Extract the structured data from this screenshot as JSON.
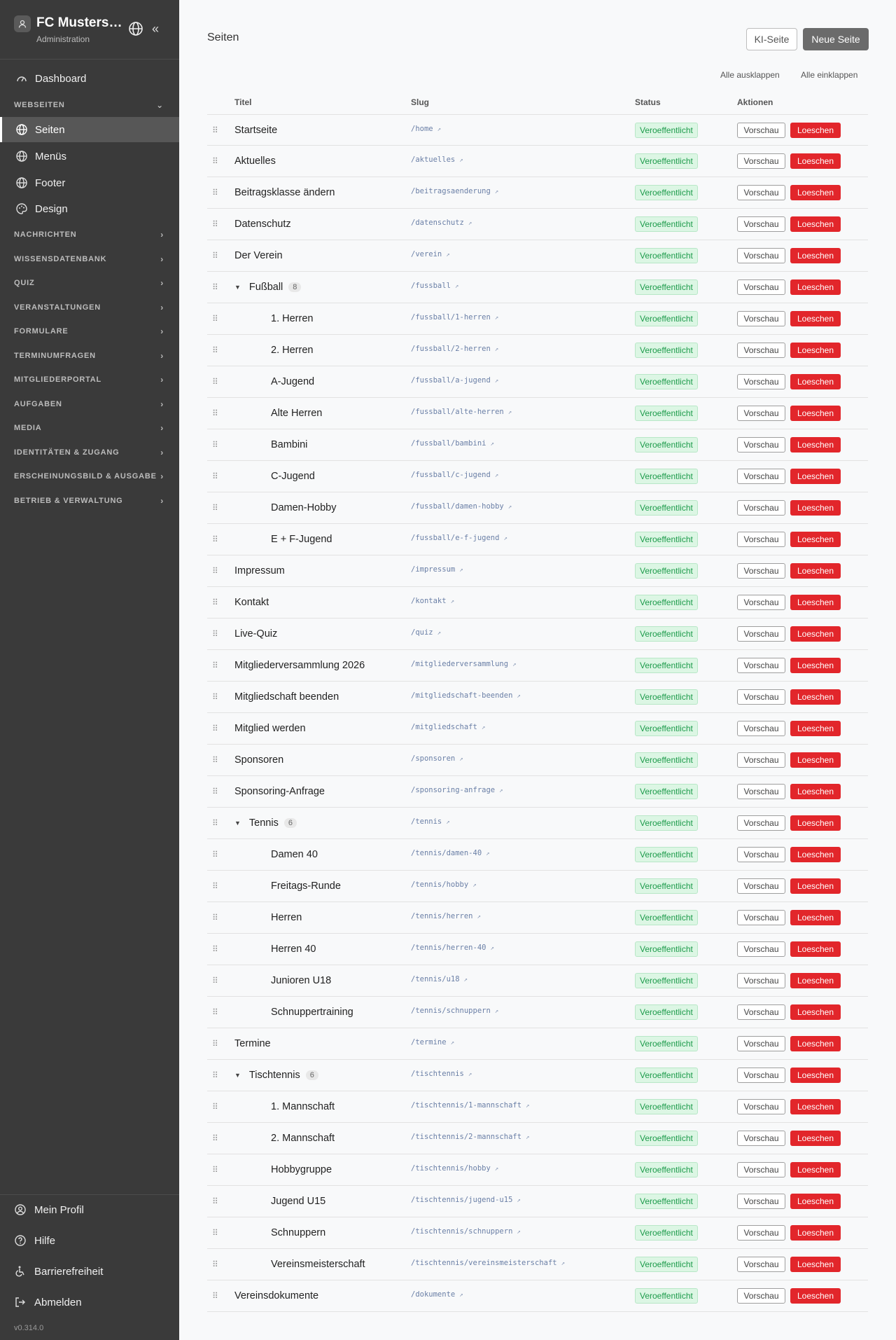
{
  "brand": {
    "name": "FC Musterst…",
    "subtitle": "Administration"
  },
  "nav": {
    "dashboard": "Dashboard",
    "webseiten_section": "WEBSEITEN",
    "webseiten_items": [
      "Seiten",
      "Menüs",
      "Footer",
      "Design"
    ],
    "sections": [
      "NACHRICHTEN",
      "WISSENSDATENBANK",
      "QUIZ",
      "VERANSTALTUNGEN",
      "FORMULARE",
      "TERMINUMFRAGEN",
      "MITGLIEDERPORTAL",
      "AUFGABEN",
      "MEDIA",
      "IDENTITÄTEN & ZUGANG",
      "ERSCHEINUNGSBILD & AUSGABE",
      "BETRIEB & VERWALTUNG"
    ]
  },
  "bottom": {
    "profile": "Mein Profil",
    "help": "Hilfe",
    "accessibility": "Barrierefreiheit",
    "logout": "Abmelden",
    "version": "v0.314.0"
  },
  "header": {
    "title": "Seiten",
    "ki_button": "KI-Seite",
    "new_button": "Neue Seite",
    "expand_all": "Alle ausklappen",
    "collapse_all": "Alle einklappen"
  },
  "table": {
    "columns": {
      "title": "Titel",
      "slug": "Slug",
      "status": "Status",
      "actions": "Aktionen"
    },
    "status_label": "Veroeffentlicht",
    "preview_label": "Vorschau",
    "delete_label": "Loeschen",
    "rows": [
      {
        "title": "Startseite",
        "slug": "/home",
        "level": 0
      },
      {
        "title": "Aktuelles",
        "slug": "/aktuelles",
        "level": 0
      },
      {
        "title": "Beitragsklasse ändern",
        "slug": "/beitragsaenderung",
        "level": 0
      },
      {
        "title": "Datenschutz",
        "slug": "/datenschutz",
        "level": 0
      },
      {
        "title": "Der Verein",
        "slug": "/verein",
        "level": 0
      },
      {
        "title": "Fußball",
        "slug": "/fussball",
        "level": 0,
        "group": true,
        "count": "8"
      },
      {
        "title": "1. Herren",
        "slug": "/fussball/1-herren",
        "level": 1
      },
      {
        "title": "2. Herren",
        "slug": "/fussball/2-herren",
        "level": 1
      },
      {
        "title": "A-Jugend",
        "slug": "/fussball/a-jugend",
        "level": 1
      },
      {
        "title": "Alte Herren",
        "slug": "/fussball/alte-herren",
        "level": 1
      },
      {
        "title": "Bambini",
        "slug": "/fussball/bambini",
        "level": 1
      },
      {
        "title": "C-Jugend",
        "slug": "/fussball/c-jugend",
        "level": 1
      },
      {
        "title": "Damen-Hobby",
        "slug": "/fussball/damen-hobby",
        "level": 1
      },
      {
        "title": "E + F-Jugend",
        "slug": "/fussball/e-f-jugend",
        "level": 1
      },
      {
        "title": "Impressum",
        "slug": "/impressum",
        "level": 0
      },
      {
        "title": "Kontakt",
        "slug": "/kontakt",
        "level": 0
      },
      {
        "title": "Live-Quiz",
        "slug": "/quiz",
        "level": 0
      },
      {
        "title": "Mitgliederversammlung 2026",
        "slug": "/mitgliederversammlung",
        "level": 0
      },
      {
        "title": "Mitgliedschaft beenden",
        "slug": "/mitgliedschaft-beenden",
        "level": 0
      },
      {
        "title": "Mitglied werden",
        "slug": "/mitgliedschaft",
        "level": 0
      },
      {
        "title": "Sponsoren",
        "slug": "/sponsoren",
        "level": 0
      },
      {
        "title": "Sponsoring-Anfrage",
        "slug": "/sponsoring-anfrage",
        "level": 0
      },
      {
        "title": "Tennis",
        "slug": "/tennis",
        "level": 0,
        "group": true,
        "count": "6"
      },
      {
        "title": "Damen 40",
        "slug": "/tennis/damen-40",
        "level": 1
      },
      {
        "title": "Freitags-Runde",
        "slug": "/tennis/hobby",
        "level": 1
      },
      {
        "title": "Herren",
        "slug": "/tennis/herren",
        "level": 1
      },
      {
        "title": "Herren 40",
        "slug": "/tennis/herren-40",
        "level": 1
      },
      {
        "title": "Junioren U18",
        "slug": "/tennis/u18",
        "level": 1
      },
      {
        "title": "Schnuppertraining",
        "slug": "/tennis/schnuppern",
        "level": 1
      },
      {
        "title": "Termine",
        "slug": "/termine",
        "level": 0
      },
      {
        "title": "Tischtennis",
        "slug": "/tischtennis",
        "level": 0,
        "group": true,
        "count": "6"
      },
      {
        "title": "1. Mannschaft",
        "slug": "/tischtennis/1-mannschaft",
        "level": 1
      },
      {
        "title": "2. Mannschaft",
        "slug": "/tischtennis/2-mannschaft",
        "level": 1
      },
      {
        "title": "Hobbygruppe",
        "slug": "/tischtennis/hobby",
        "level": 1
      },
      {
        "title": "Jugend U15",
        "slug": "/tischtennis/jugend-u15",
        "level": 1
      },
      {
        "title": "Schnuppern",
        "slug": "/tischtennis/schnuppern",
        "level": 1
      },
      {
        "title": "Vereinsmeisterschaft",
        "slug": "/tischtennis/vereinsmeisterschaft",
        "level": 1
      },
      {
        "title": "Vereinsdokumente",
        "slug": "/dokumente",
        "level": 0
      }
    ]
  }
}
